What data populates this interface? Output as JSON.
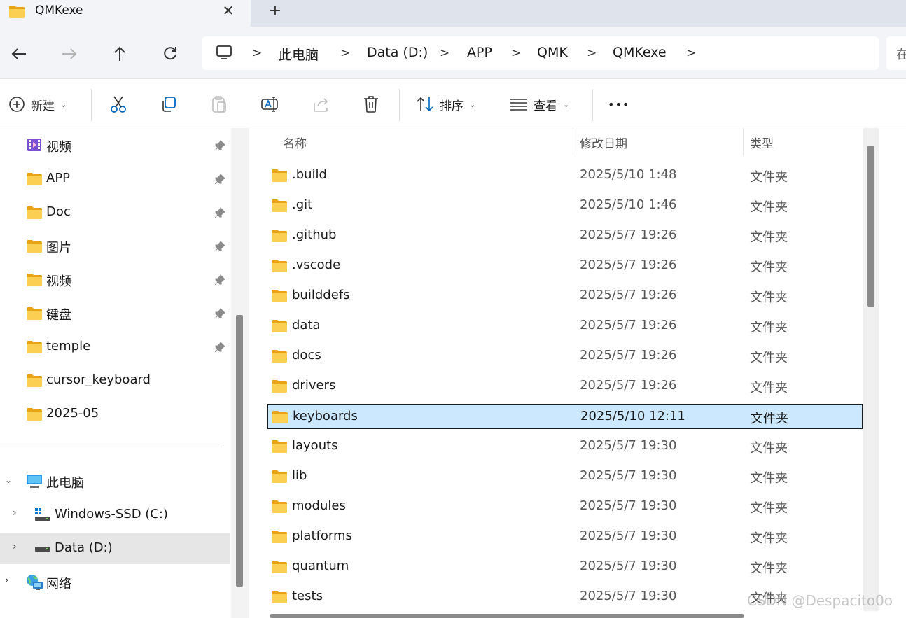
{
  "window": {
    "tab_title": "QMKexe",
    "close_glyph": "✕",
    "new_tab_glyph": "+"
  },
  "address": {
    "crumbs": [
      "此电脑",
      "Data (D:)",
      "APP",
      "QMK",
      "QMKexe"
    ],
    "separator": ">",
    "search_placeholder_partial": "在"
  },
  "toolbar": {
    "new_label": "新建",
    "sort_label": "排序",
    "view_label": "查看",
    "more_glyph": "•••",
    "chevron": "⌄"
  },
  "sidebar": {
    "quick_access": [
      {
        "label": "视频",
        "icon": "video-folder-icon",
        "pinned": true
      },
      {
        "label": "APP",
        "icon": "folder-icon",
        "pinned": true
      },
      {
        "label": "Doc",
        "icon": "folder-icon",
        "pinned": true
      },
      {
        "label": "图片",
        "icon": "folder-icon",
        "pinned": true
      },
      {
        "label": "视频",
        "icon": "folder-icon",
        "pinned": true
      },
      {
        "label": "键盘",
        "icon": "folder-icon",
        "pinned": true
      },
      {
        "label": "temple",
        "icon": "folder-icon",
        "pinned": true
      },
      {
        "label": "cursor_keyboard",
        "icon": "folder-icon",
        "pinned": false
      },
      {
        "label": "2025-05",
        "icon": "folder-icon",
        "pinned": false
      }
    ],
    "this_pc": {
      "label": "此电脑",
      "expanded": true
    },
    "drives": [
      {
        "label": "Windows-SSD (C:)",
        "icon": "windows-drive-icon",
        "selected": false
      },
      {
        "label": "Data (D:)",
        "icon": "drive-icon",
        "selected": true
      }
    ],
    "network": {
      "label": "网络"
    },
    "expand_glyph": "›",
    "collapse_glyph": "⌄"
  },
  "files": {
    "columns": {
      "name": "名称",
      "modified": "修改日期",
      "type": "类型"
    },
    "sort_indicator": "^",
    "rows": [
      {
        "name": ".build",
        "modified": "2025/5/10 1:48",
        "type": "文件夹",
        "selected": false
      },
      {
        "name": ".git",
        "modified": "2025/5/10 1:46",
        "type": "文件夹",
        "selected": false
      },
      {
        "name": ".github",
        "modified": "2025/5/7 19:26",
        "type": "文件夹",
        "selected": false
      },
      {
        "name": ".vscode",
        "modified": "2025/5/7 19:26",
        "type": "文件夹",
        "selected": false
      },
      {
        "name": "builddefs",
        "modified": "2025/5/7 19:26",
        "type": "文件夹",
        "selected": false
      },
      {
        "name": "data",
        "modified": "2025/5/7 19:26",
        "type": "文件夹",
        "selected": false
      },
      {
        "name": "docs",
        "modified": "2025/5/7 19:26",
        "type": "文件夹",
        "selected": false
      },
      {
        "name": "drivers",
        "modified": "2025/5/7 19:26",
        "type": "文件夹",
        "selected": false
      },
      {
        "name": "keyboards",
        "modified": "2025/5/10 12:11",
        "type": "文件夹",
        "selected": true
      },
      {
        "name": "layouts",
        "modified": "2025/5/7 19:30",
        "type": "文件夹",
        "selected": false
      },
      {
        "name": "lib",
        "modified": "2025/5/7 19:30",
        "type": "文件夹",
        "selected": false
      },
      {
        "name": "modules",
        "modified": "2025/5/7 19:30",
        "type": "文件夹",
        "selected": false
      },
      {
        "name": "platforms",
        "modified": "2025/5/7 19:30",
        "type": "文件夹",
        "selected": false
      },
      {
        "name": "quantum",
        "modified": "2025/5/7 19:30",
        "type": "文件夹",
        "selected": false
      },
      {
        "name": "tests",
        "modified": "2025/5/7 19:30",
        "type": "文件夹",
        "selected": false
      }
    ]
  },
  "watermark": "CSDN @Despacito0o",
  "colors": {
    "selection_bg": "#cce8ff",
    "folder_yellow": "#f8c84a",
    "accent": "#0067c0"
  }
}
